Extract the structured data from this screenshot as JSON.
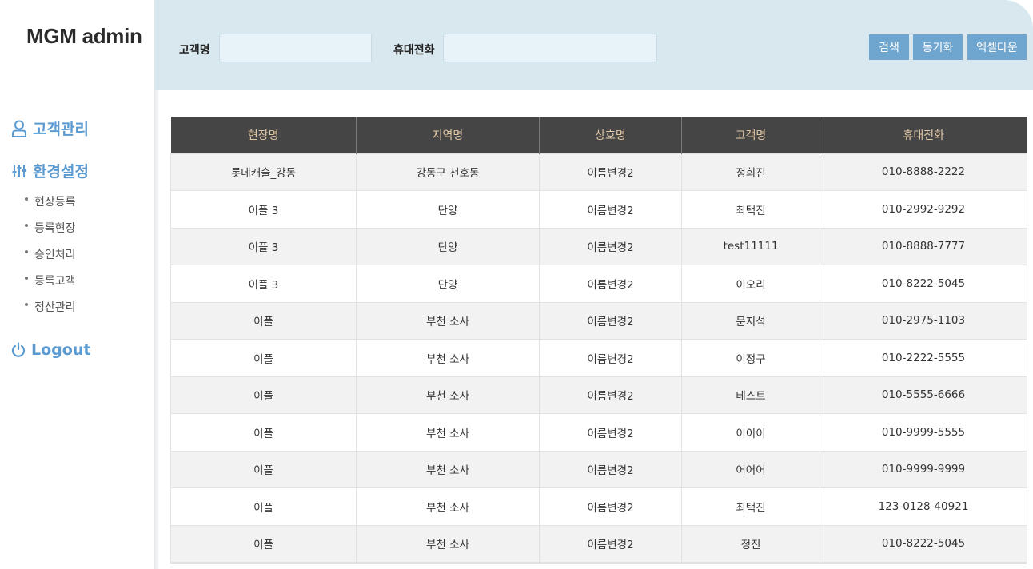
{
  "app": {
    "title": "MGM admin"
  },
  "sidebar": {
    "customer_label": "고객관리",
    "settings_label": "환경설정",
    "sub_items": [
      "현장등록",
      "등록현장",
      "승인처리",
      "등록고객",
      "정산관리"
    ],
    "logout_label": "Logout",
    "accent_color": "#5b9bd1",
    "icons": {
      "customer": "user-icon",
      "settings": "sliders-icon",
      "logout": "power-icon"
    }
  },
  "search": {
    "name_label": "고객명",
    "name_value": "",
    "phone_label": "휴대전화",
    "phone_value": "",
    "search_button": "검색",
    "sync_button": "동기화",
    "excel_button": "엑셀다운",
    "button_color": "#6fa6cf"
  },
  "table": {
    "columns": [
      "현장명",
      "지역명",
      "상호명",
      "고객명",
      "휴대전화"
    ],
    "rows": [
      [
        "롯데캐슬_강동",
        "강동구 천호동",
        "이름변경2",
        "정희진",
        "010-8888-2222"
      ],
      [
        "이플 3",
        "단양",
        "이름변경2",
        "최택진",
        "010-2992-9292"
      ],
      [
        "이플 3",
        "단양",
        "이름변경2",
        "test11111",
        "010-8888-7777"
      ],
      [
        "이플 3",
        "단양",
        "이름변경2",
        "이오리",
        "010-8222-5045"
      ],
      [
        "이플",
        "부천 소사",
        "이름변경2",
        "문지석",
        "010-2975-1103"
      ],
      [
        "이플",
        "부천 소사",
        "이름변경2",
        "이정구",
        "010-2222-5555"
      ],
      [
        "이플",
        "부천 소사",
        "이름변경2",
        "테스트",
        "010-5555-6666"
      ],
      [
        "이플",
        "부천 소사",
        "이름변경2",
        "이이이",
        "010-9999-5555"
      ],
      [
        "이플",
        "부천 소사",
        "이름변경2",
        "어어어",
        "010-9999-9999"
      ],
      [
        "이플",
        "부천 소사",
        "이름변경2",
        "최택진",
        "123-0128-40921"
      ],
      [
        "이플",
        "부천 소사",
        "이름변경2",
        "정진",
        "010-8222-5045"
      ]
    ]
  }
}
